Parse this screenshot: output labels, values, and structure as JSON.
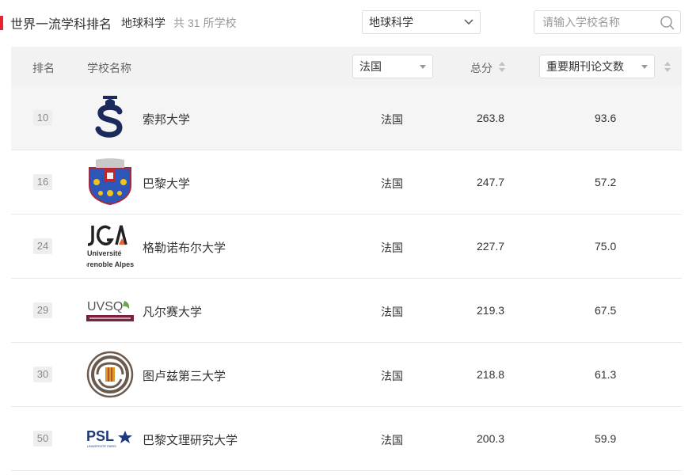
{
  "header": {
    "title": "世界一流学科排名",
    "subject": "地球科学",
    "count_prefix": "共",
    "count": "31",
    "count_suffix": "所学校"
  },
  "subject_select": {
    "value": "地球科学"
  },
  "search": {
    "placeholder": "请输入学校名称"
  },
  "table": {
    "col_rank": "排名",
    "col_name": "学校名称",
    "country_filter": "法国",
    "col_score": "总分",
    "indicator_select": "重要期刊论文数"
  },
  "rows": [
    {
      "rank": "10",
      "name": "索邦大学",
      "country": "法国",
      "score": "263.8",
      "papers": "93.6",
      "logo": "sorbonne-logo"
    },
    {
      "rank": "16",
      "name": "巴黎大学",
      "country": "法国",
      "score": "247.7",
      "papers": "57.2",
      "logo": "universite-paris-crest"
    },
    {
      "rank": "24",
      "name": "格勒诺布尔大学",
      "country": "法国",
      "score": "227.7",
      "papers": "75.0",
      "logo": "uga-logo",
      "logo_text": [
        "UGA",
        "Université",
        "Grenoble Alpes"
      ]
    },
    {
      "rank": "29",
      "name": "凡尔赛大学",
      "country": "法国",
      "score": "219.3",
      "papers": "67.5",
      "logo": "uvsq-logo",
      "logo_text": [
        "UVSQ"
      ]
    },
    {
      "rank": "30",
      "name": "图卢兹第三大学",
      "country": "法国",
      "score": "218.8",
      "papers": "61.3",
      "logo": "toulouse-seal"
    },
    {
      "rank": "50",
      "name": "巴黎文理研究大学",
      "country": "法国",
      "score": "200.3",
      "papers": "59.9",
      "logo": "psl-logo",
      "logo_text": [
        "PSL",
        "UNIVERSITÉ PARIS"
      ]
    }
  ],
  "colors": {
    "accent": "#e8222e",
    "header_bg": "#f2f2f2",
    "row_highlight": "#f5f5f5"
  }
}
